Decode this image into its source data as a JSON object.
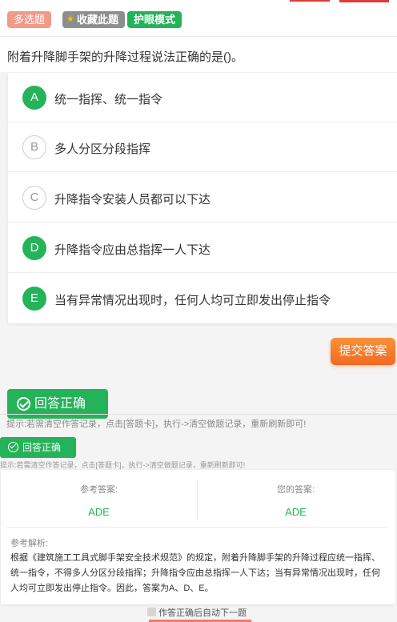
{
  "header": {
    "type_tag": "多选题",
    "favorite_label": "收藏此题",
    "eye_mode_label": "护眼模式"
  },
  "question": {
    "text": "附着升降脚手架的升降过程说法正确的是()。"
  },
  "options": [
    {
      "letter": "A",
      "text": "统一指挥、统一指令",
      "selected": true
    },
    {
      "letter": "B",
      "text": "多人分区分段指挥",
      "selected": false
    },
    {
      "letter": "C",
      "text": "升降指令安装人员都可以下达",
      "selected": false
    },
    {
      "letter": "D",
      "text": "升降指令应由总指挥一人下达",
      "selected": true
    },
    {
      "letter": "E",
      "text": "当有异常情况出现时，任何人均可立即发出停止指令",
      "selected": true
    }
  ],
  "submit_label": "提交答案",
  "result": {
    "label": "回答正确",
    "hint": "提示:若需清空作答记录，点击[答题卡]，执行->清空做题记录，重新刷新即可!"
  },
  "answer": {
    "reference_label": "参考答案:",
    "reference_value": "ADE",
    "yours_label": "您的答案:",
    "yours_value": "ADE",
    "analysis_label": "参考解析:",
    "analysis_text": "根据《建筑施工工具式脚手架安全技术规范》的规定，附着升降脚手架的升降过程应统一指挥、统一指令，不得多人分区分段指挥；升降指令应由总指挥一人下达；当有异常情况出现时，任何人均可立即发出停止指令。因此，答案为A、D、E。"
  },
  "auto_next_label": "作答正确后自动下一题",
  "colors": {
    "accent_green": "#25b35a",
    "submit_orange": "#f26a22",
    "type_tag": "#f19a8a"
  }
}
